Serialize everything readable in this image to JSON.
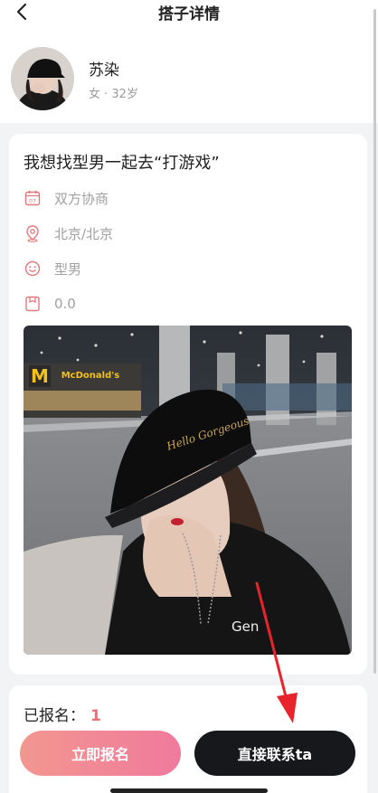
{
  "header": {
    "title": "搭子详情",
    "back_icon": "chevron-left-icon"
  },
  "profile": {
    "name": "苏染",
    "meta": "女 · 32岁"
  },
  "post": {
    "title": "我想找型男一起去“打游戏”",
    "details": [
      {
        "icon": "calendar-icon",
        "text": "双方协商"
      },
      {
        "icon": "location-pin-icon",
        "text": "北京/北京"
      },
      {
        "icon": "smiley-face-icon",
        "text": "型男"
      },
      {
        "icon": "price-tag-icon",
        "text": "0.0"
      }
    ],
    "photo_sign_text": "McDonald's"
  },
  "signup": {
    "label": "已报名：",
    "count": "1"
  },
  "actions": {
    "join_label": "立即报名",
    "contact_label": "直接联系ta"
  },
  "colors": {
    "accent_pink": "#f07a9c",
    "count_pink": "#f06e7a",
    "dark_button": "#16181c"
  }
}
